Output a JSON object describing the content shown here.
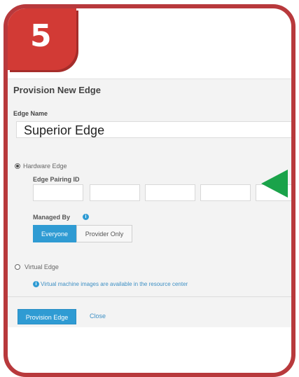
{
  "step": {
    "number": "5"
  },
  "dialog": {
    "title": "Provision New Edge",
    "edge_name_label": "Edge Name",
    "edge_name_value": "Superior Edge",
    "hardware": {
      "label": "Hardware Edge",
      "selected": true,
      "pairing_label": "Edge Pairing ID",
      "pairing_values": [
        "",
        "",
        "",
        "",
        ""
      ],
      "managed_by_label": "Managed By",
      "managed_by_options": [
        "Everyone",
        "Provider Only"
      ],
      "managed_by_selected": "Everyone"
    },
    "virtual": {
      "label": "Virtual Edge",
      "selected": false,
      "note": "Virtual machine images are available in the resource center"
    },
    "buttons": {
      "primary": "Provision Edge",
      "secondary": "Close"
    }
  },
  "colors": {
    "frame": "#b8393c",
    "badge": "#d23a35",
    "accent": "#2f9bd3",
    "arrow": "#1aa34a"
  },
  "icons": [
    "info-icon",
    "arrow-pointer-icon"
  ]
}
